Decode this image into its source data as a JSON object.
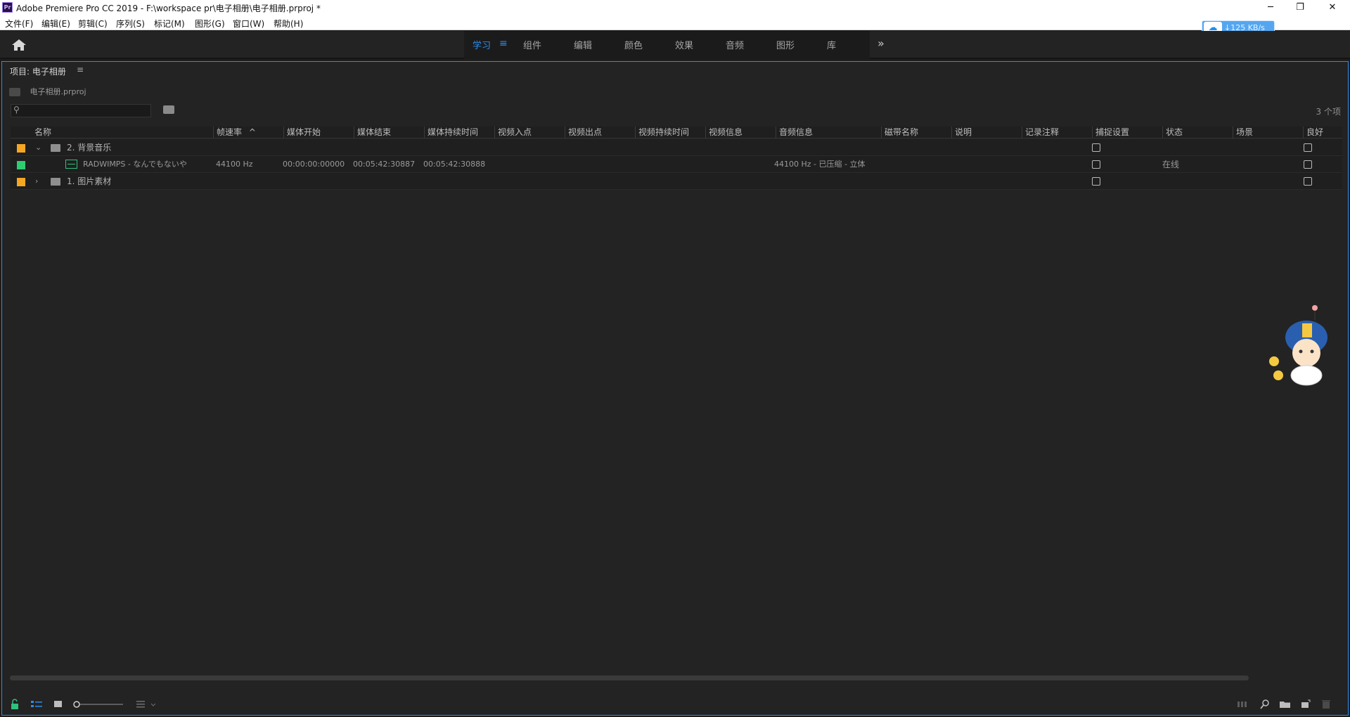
{
  "window": {
    "title": "Adobe Premiere Pro CC 2019 - F:\\workspace pr\\电子相册\\电子相册.prproj *",
    "app_icon": "Pr",
    "controls": {
      "minimize": "─",
      "restore": "❐",
      "close": "✕"
    }
  },
  "menu": [
    "文件(F)",
    "编辑(E)",
    "剪辑(C)",
    "序列(S)",
    "标记(M)",
    "图形(G)",
    "窗口(W)",
    "帮助(H)"
  ],
  "network": {
    "speed": "↓125 KB/s"
  },
  "workspaces": {
    "tabs": [
      "学习",
      "组件",
      "编辑",
      "颜色",
      "效果",
      "音频",
      "图形",
      "库"
    ],
    "active": "学习",
    "menu_glyph": "≡",
    "overflow_glyph": "»"
  },
  "panel": {
    "title": "项目: 电子相册",
    "menu_glyph": "≡",
    "project_file": "电子相册.prproj",
    "search": {
      "placeholder": "",
      "value": ""
    },
    "item_count": "3 个项"
  },
  "table": {
    "columns": [
      "名称",
      "帧速率",
      "媒体开始",
      "媒体结束",
      "媒体持续时间",
      "视频入点",
      "视频出点",
      "视频持续时间",
      "视频信息",
      "音频信息",
      "磁带名称",
      "说明",
      "记录注释",
      "捕捉设置",
      "状态",
      "场景",
      "良好"
    ],
    "sort_indicator": "^",
    "rows": [
      {
        "name": "2. 背景音乐",
        "twisty": "⌄",
        "label_color": "#f5a623",
        "kind": "bin"
      },
      {
        "name": "RADWIMPS - なんでもないや",
        "label_color": "#2ecc71",
        "kind": "audio",
        "frame_rate": "44100 Hz",
        "media_start": "00:00:00:00000",
        "media_end": "00:05:42:30887",
        "media_duration": "00:05:42:30888",
        "audio_info": "44100 Hz - 已压缩 - 立体",
        "status": "在线"
      },
      {
        "name": "1. 图片素材",
        "twisty": "›",
        "label_color": "#f5a623",
        "kind": "bin"
      }
    ]
  },
  "icons": {
    "home": "home-icon",
    "search": "search-icon",
    "bin": "bin-icon",
    "folder": "folder-icon",
    "audio_clip": "audio-clip-icon"
  }
}
